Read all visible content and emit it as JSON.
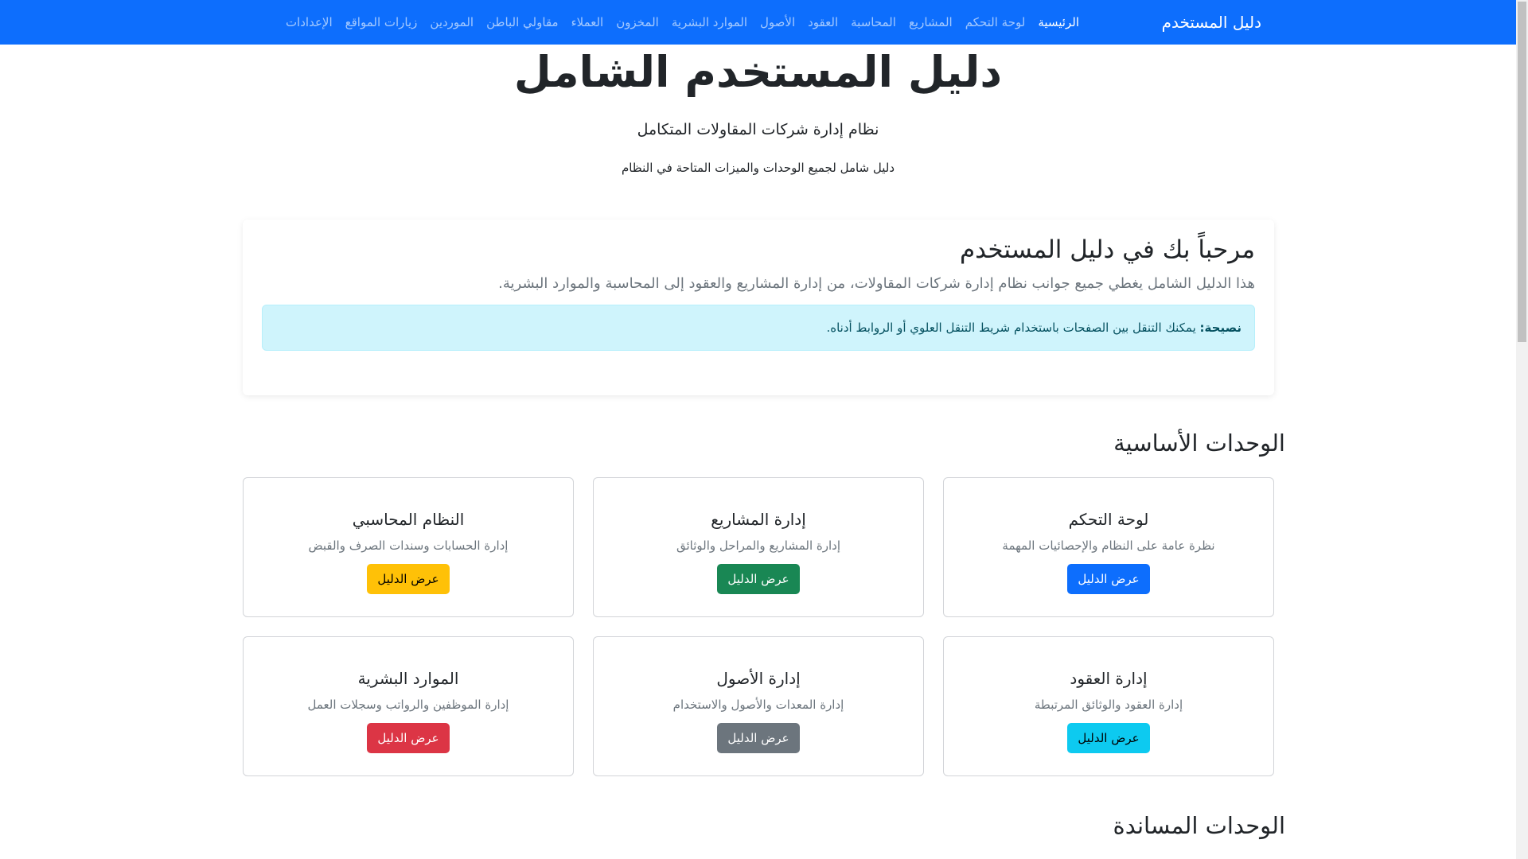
{
  "nav": {
    "brand": "دليل المستخدم",
    "links": [
      "الرئيسية",
      "لوحة التحكم",
      "المشاريع",
      "المحاسبة",
      "العقود",
      "الأصول",
      "الموارد البشرية",
      "المخزون",
      "العملاء",
      "مقاولي الباطن",
      "الموردين",
      "زيارات المواقع",
      "الإعدادات"
    ],
    "active_index": 0
  },
  "hero": {
    "title": "دليل المستخدم الشامل",
    "subtitle": "نظام إدارة شركات المقاولات المتكامل",
    "description": "دليل شامل لجميع الوحدات والميزات المتاحة في النظام"
  },
  "welcome": {
    "title": "مرحباً بك في دليل المستخدم",
    "text": "هذا الدليل الشامل يغطي جميع جوانب نظام إدارة شركات المقاولات، من إدارة المشاريع والعقود إلى المحاسبة والموارد البشرية.",
    "tip_label": "نصيحة:",
    "tip_text": " يمكنك التنقل بين الصفحات باستخدام شريط التنقل العلوي أو الروابط أدناه."
  },
  "core_section": {
    "title": "الوحدات الأساسية",
    "cards": [
      {
        "title": "لوحة التحكم",
        "desc": "نظرة عامة على النظام والإحصائيات المهمة",
        "button": "عرض الدليل",
        "color": "#0d6efd"
      },
      {
        "title": "إدارة المشاريع",
        "desc": "إدارة المشاريع والمراحل والوثائق",
        "button": "عرض الدليل",
        "color": "#198754"
      },
      {
        "title": "النظام المحاسبي",
        "desc": "إدارة الحسابات وسندات الصرف والقبض",
        "button": "عرض الدليل",
        "color": "#ffc107"
      },
      {
        "title": "إدارة العقود",
        "desc": "إدارة العقود والوثائق المرتبطة",
        "button": "عرض الدليل",
        "color": "#0dcaf0"
      },
      {
        "title": "إدارة الأصول",
        "desc": "إدارة المعدات والأصول والاستخدام",
        "button": "عرض الدليل",
        "color": "#6c757d"
      },
      {
        "title": "الموارد البشرية",
        "desc": "إدارة الموظفين والرواتب وسجلات العمل",
        "button": "عرض الدليل",
        "color": "#dc3545"
      }
    ]
  },
  "support_section": {
    "title": "الوحدات المساندة"
  }
}
